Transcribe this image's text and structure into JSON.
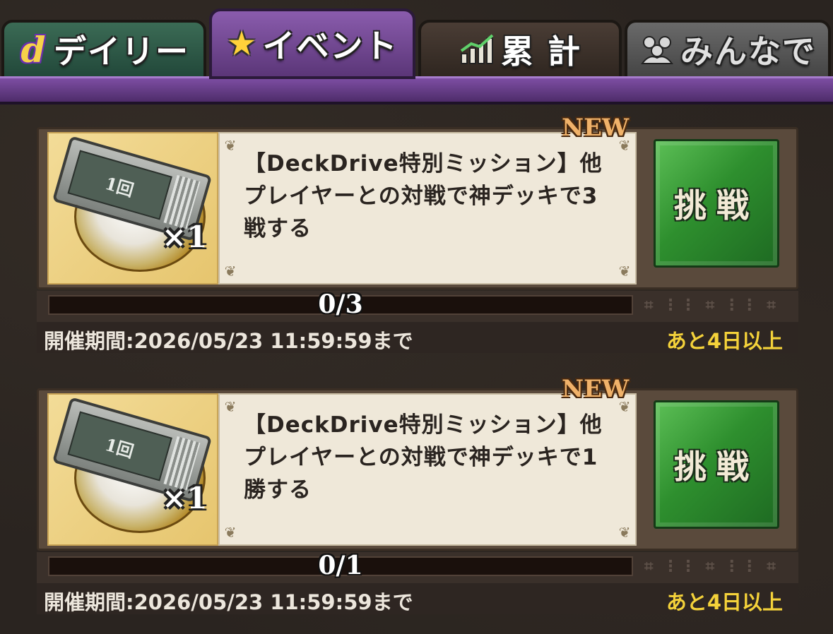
{
  "tabs": {
    "daily": {
      "label": "デイリー",
      "icon": "d"
    },
    "event": {
      "label": "イベント",
      "icon": "★"
    },
    "total": {
      "label": "累 計",
      "icon": "chart-icon"
    },
    "all": {
      "label": "みんなで",
      "icon": "people-icon"
    }
  },
  "active_tab": "event",
  "missions": [
    {
      "new_badge": "NEW",
      "ticket_label": "1回",
      "reward_qty": "×1",
      "text": "【DeckDrive特別ミッション】他プレイヤーとの対戦で神デッキで3戦する",
      "button_label": "挑戦",
      "progress_text": "0/3",
      "progress": 0.0,
      "period": "開催期間:2026/05/23 11:59:59まで",
      "remaining": "あと4日以上"
    },
    {
      "new_badge": "NEW",
      "ticket_label": "1回",
      "reward_qty": "×1",
      "text": "【DeckDrive特別ミッション】他プレイヤーとの対戦で神デッキで1勝する",
      "button_label": "挑戦",
      "progress_text": "0/1",
      "progress": 0.0,
      "period": "開催期間:2026/05/23 11:59:59まで",
      "remaining": "あと4日以上"
    }
  ],
  "colors": {
    "event_tab": "#7d4ea3",
    "challenge_button": "#2e8f2e",
    "remaining_text": "#f4d23a"
  }
}
